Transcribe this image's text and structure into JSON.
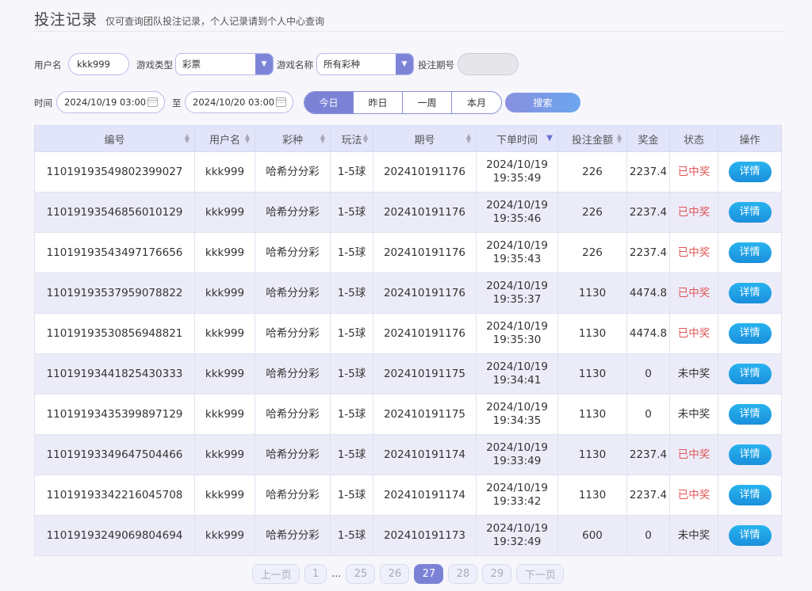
{
  "header": {
    "title": "投注记录",
    "subtitle": "仅可查询团队投注记录，个人记录请到个人中心查询"
  },
  "filters": {
    "username_label": "用户名",
    "username_value": "kkk999",
    "game_type_label": "游戏类型",
    "game_type_value": "彩票",
    "game_name_label": "游戏名称",
    "game_name_value": "所有彩种",
    "period_label": "投注期号",
    "period_value": "",
    "time_label": "时间",
    "time_from": "2024/10/19 03:00",
    "to_label": "至",
    "time_to": "2024/10/20 03:00",
    "ranges": [
      "今日",
      "昨日",
      "一周",
      "本月"
    ],
    "active_range": "今日",
    "search_label": "搜索"
  },
  "table": {
    "columns": [
      "编号",
      "用户名",
      "彩种",
      "玩法",
      "期号",
      "下单时间",
      "投注金额",
      "奖金",
      "状态",
      "操作"
    ],
    "rows": [
      {
        "id": "110191935498023990​27",
        "user": "kkk999",
        "lottery": "哈希分分彩",
        "play": "1-5球",
        "period": "202410191176",
        "date": "2024/10/19",
        "time": "19:35:49",
        "amount": "226",
        "prize": "2237.4",
        "status": "已中奖",
        "action": "详情"
      },
      {
        "id": "11019193546856010129",
        "user": "kkk999",
        "lottery": "哈希分分彩",
        "play": "1-5球",
        "period": "202410191176",
        "date": "2024/10/19",
        "time": "19:35:46",
        "amount": "226",
        "prize": "2237.4",
        "status": "已中奖",
        "action": "详情"
      },
      {
        "id": "11019193543497176656",
        "user": "kkk999",
        "lottery": "哈希分分彩",
        "play": "1-5球",
        "period": "202410191176",
        "date": "2024/10/19",
        "time": "19:35:43",
        "amount": "226",
        "prize": "2237.4",
        "status": "已中奖",
        "action": "详情"
      },
      {
        "id": "11019193537959078822",
        "user": "kkk999",
        "lottery": "哈希分分彩",
        "play": "1-5球",
        "period": "202410191176",
        "date": "2024/10/19",
        "time": "19:35:37",
        "amount": "1130",
        "prize": "4474.8",
        "status": "已中奖",
        "action": "详情"
      },
      {
        "id": "11019193530856948821",
        "user": "kkk999",
        "lottery": "哈希分分彩",
        "play": "1-5球",
        "period": "202410191176",
        "date": "2024/10/19",
        "time": "19:35:30",
        "amount": "1130",
        "prize": "4474.8",
        "status": "已中奖",
        "action": "详情"
      },
      {
        "id": "11019193441825430333",
        "user": "kkk999",
        "lottery": "哈希分分彩",
        "play": "1-5球",
        "period": "202410191175",
        "date": "2024/10/19",
        "time": "19:34:41",
        "amount": "1130",
        "prize": "0",
        "status": "未中奖",
        "action": "详情"
      },
      {
        "id": "11019193435399897129",
        "user": "kkk999",
        "lottery": "哈希分分彩",
        "play": "1-5球",
        "period": "202410191175",
        "date": "2024/10/19",
        "time": "19:34:35",
        "amount": "1130",
        "prize": "0",
        "status": "未中奖",
        "action": "详情"
      },
      {
        "id": "11019193349647504466",
        "user": "kkk999",
        "lottery": "哈希分分彩",
        "play": "1-5球",
        "period": "202410191174",
        "date": "2024/10/19",
        "time": "19:33:49",
        "amount": "1130",
        "prize": "2237.4",
        "status": "已中奖",
        "action": "详情"
      },
      {
        "id": "11019193342216045708",
        "user": "kkk999",
        "lottery": "哈希分分彩",
        "play": "1-5球",
        "period": "202410191174",
        "date": "2024/10/19",
        "time": "19:33:42",
        "amount": "1130",
        "prize": "2237.4",
        "status": "已中奖",
        "action": "详情"
      },
      {
        "id": "11019193249069804694",
        "user": "kkk999",
        "lottery": "哈希分分彩",
        "play": "1-5球",
        "period": "202410191173",
        "date": "2024/10/19",
        "time": "19:32:49",
        "amount": "600",
        "prize": "0",
        "status": "未中奖",
        "action": "详情"
      }
    ]
  },
  "pagination": {
    "prev": "上一页",
    "next": "下一页",
    "first": "1",
    "ellipsis": "...",
    "pages": [
      "25",
      "26",
      "27",
      "28",
      "29"
    ],
    "current": "27"
  },
  "colors": {
    "accent": "#7b82d6",
    "win": "#e05555",
    "detail_button": "#1b8fdc"
  }
}
